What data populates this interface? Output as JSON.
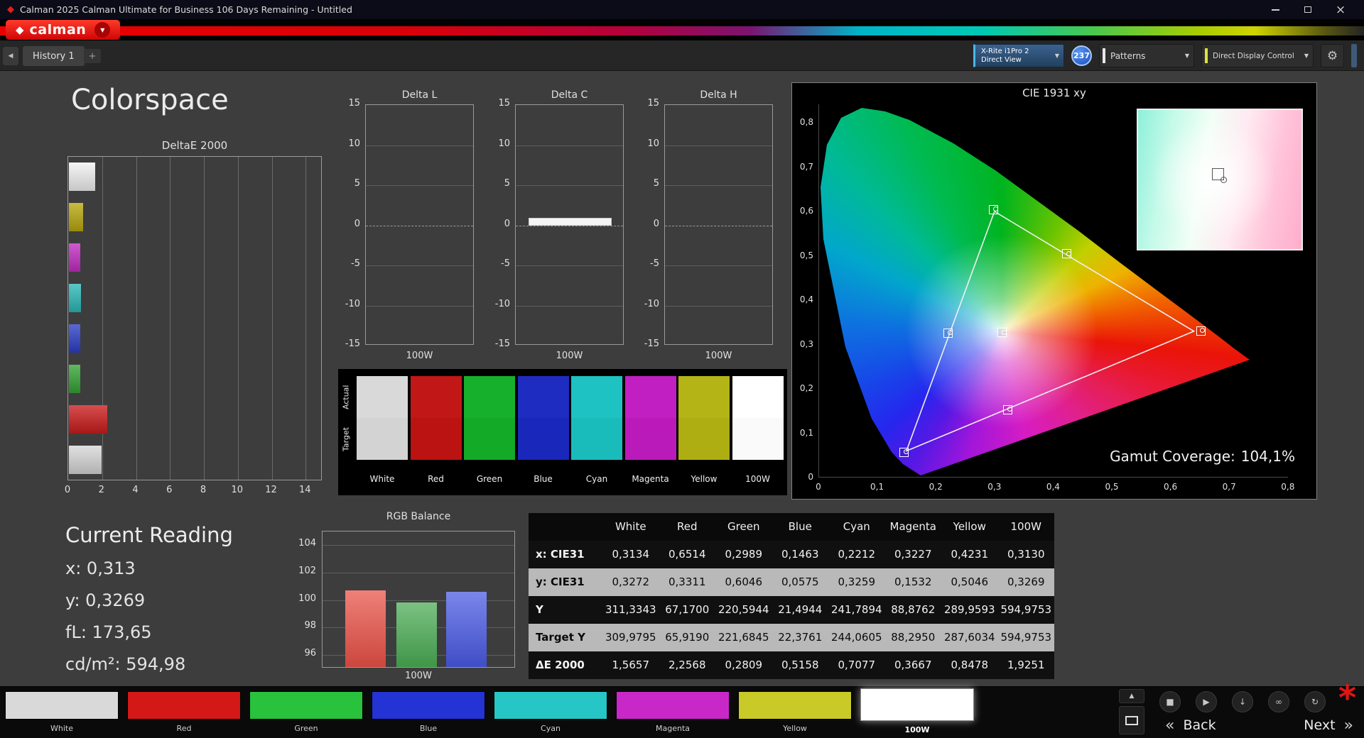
{
  "window": {
    "title": "Calman 2025 Calman Ultimate for Business 106 Days Remaining  - Untitled"
  },
  "brand": {
    "name": "calman"
  },
  "icons": {
    "app": "◆",
    "brand_mark": "◆",
    "dropdown": "▼",
    "close": "×",
    "nav_left": "◀",
    "add": "+",
    "gear": "⚙",
    "collapse_up": "▲",
    "stop": "■",
    "play": "▶",
    "save": "↓",
    "link": "∞",
    "refresh": "↻",
    "back_chevron": "«",
    "next_chevron": "»",
    "alert": "*"
  },
  "toolbar": {
    "tab": "History 1",
    "meter_line1": "X-Rite i1Pro 2",
    "meter_line2": "Direct View",
    "meter_badge": "237",
    "patterns_label": "Patterns",
    "display_control_label": "Direct Display Control"
  },
  "page_title": "Colorspace",
  "current_reading": {
    "title": "Current Reading",
    "lines": [
      "x: 0,313",
      "y: 0,3269",
      "fL: 173,65",
      "cd/m²: 594,98"
    ]
  },
  "gamut": {
    "label": "Gamut Coverage:",
    "value": "104,1%"
  },
  "swatch_strip": {
    "row_labels": [
      "Actual",
      "Target"
    ],
    "columns": [
      {
        "label": "White",
        "actual": "#d9d9d9",
        "target": "#d3d3d3"
      },
      {
        "label": "Red",
        "actual": "#c21717",
        "target": "#bb1212"
      },
      {
        "label": "Green",
        "actual": "#17b02c",
        "target": "#12aa27"
      },
      {
        "label": "Blue",
        "actual": "#1f2cc2",
        "target": "#1a27bb"
      },
      {
        "label": "Cyan",
        "actual": "#1fc2c2",
        "target": "#1abbbb"
      },
      {
        "label": "Magenta",
        "actual": "#c21fc2",
        "target": "#bb1abb"
      },
      {
        "label": "Yellow",
        "actual": "#b4b417",
        "target": "#aeae12"
      },
      {
        "label": "100W",
        "actual": "#ffffff",
        "target": "#fafafa"
      }
    ]
  },
  "bottom_bar": {
    "back": "Back",
    "next": "Next",
    "swatches": [
      {
        "label": "White",
        "color": "#d9d9d9",
        "selected": false
      },
      {
        "label": "Red",
        "color": "#d41818",
        "selected": false
      },
      {
        "label": "Green",
        "color": "#28c23c",
        "selected": false
      },
      {
        "label": "Blue",
        "color": "#2433d4",
        "selected": false
      },
      {
        "label": "Cyan",
        "color": "#26c6c6",
        "selected": false
      },
      {
        "label": "Magenta",
        "color": "#c928c9",
        "selected": false
      },
      {
        "label": "Yellow",
        "color": "#c9c928",
        "selected": false
      },
      {
        "label": "100W",
        "color": "#ffffff",
        "selected": true
      }
    ]
  },
  "chart_data": [
    {
      "id": "deltaE2000",
      "type": "bar",
      "orientation": "horizontal",
      "title": "DeltaE 2000",
      "categories": [
        "White",
        "Yellow",
        "Magenta",
        "Cyan",
        "Blue",
        "Green",
        "Red",
        "100W"
      ],
      "values": [
        1.5657,
        0.8478,
        0.3667,
        0.7077,
        0.5158,
        0.2809,
        2.2568,
        1.9251
      ],
      "bar_colors": [
        "#f2f2f2",
        "#b8a80e",
        "#c22cc2",
        "#2cb8b8",
        "#2c3ec8",
        "#34a434",
        "#cc1c1c",
        "#d8d8d8"
      ],
      "xlim": [
        0,
        15
      ],
      "xticks": [
        0,
        2,
        4,
        6,
        8,
        10,
        12,
        14
      ]
    },
    {
      "id": "deltaL",
      "type": "bar",
      "title": "Delta L",
      "categories": [
        "100W"
      ],
      "values": [
        0
      ],
      "ylim": [
        -15,
        15
      ],
      "yticks": [
        15,
        10,
        5,
        0,
        -5,
        -10,
        -15
      ],
      "xlabel": "100W"
    },
    {
      "id": "deltaC",
      "type": "bar",
      "title": "Delta C",
      "categories": [
        "100W"
      ],
      "values": [
        0.9
      ],
      "ylim": [
        -15,
        15
      ],
      "yticks": [
        15,
        10,
        5,
        0,
        -5,
        -10,
        -15
      ],
      "xlabel": "100W"
    },
    {
      "id": "deltaH",
      "type": "bar",
      "title": "Delta H",
      "categories": [
        "100W"
      ],
      "values": [
        0
      ],
      "ylim": [
        -15,
        15
      ],
      "yticks": [
        15,
        10,
        5,
        0,
        -5,
        -10,
        -15
      ],
      "xlabel": "100W"
    },
    {
      "id": "rgbBalance",
      "type": "bar",
      "title": "RGB Balance",
      "categories": [
        "Red",
        "Green",
        "Blue"
      ],
      "values": [
        100.6,
        99.7,
        100.5
      ],
      "bar_colors": [
        "#e85045",
        "#48aa52",
        "#4858e2"
      ],
      "ylim": [
        95,
        105
      ],
      "yticks": [
        96,
        98,
        100,
        102,
        104
      ],
      "xlabel": "100W"
    },
    {
      "id": "cie",
      "type": "scatter",
      "title": "CIE 1931 xy",
      "xlim": [
        0,
        0.8
      ],
      "ylim": [
        0,
        0.85
      ],
      "xticks": [
        0,
        0.1,
        0.2,
        0.3,
        0.4,
        0.5,
        0.6,
        0.7,
        0.8
      ],
      "yticks": [
        0,
        0.1,
        0.2,
        0.3,
        0.4,
        0.5,
        0.6,
        0.7,
        0.8
      ],
      "gamut_triangle": [
        [
          0.64,
          0.33
        ],
        [
          0.3,
          0.6
        ],
        [
          0.15,
          0.06
        ]
      ],
      "points": [
        {
          "name": "White",
          "x": 0.3134,
          "y": 0.3272
        },
        {
          "name": "Red",
          "x": 0.6514,
          "y": 0.3311
        },
        {
          "name": "Green",
          "x": 0.2989,
          "y": 0.6046
        },
        {
          "name": "Blue",
          "x": 0.1463,
          "y": 0.0575
        },
        {
          "name": "Cyan",
          "x": 0.2212,
          "y": 0.3259
        },
        {
          "name": "Magenta",
          "x": 0.3227,
          "y": 0.1532
        },
        {
          "name": "Yellow",
          "x": 0.4231,
          "y": 0.5046
        }
      ],
      "gamut_coverage": "104,1%"
    },
    {
      "id": "measurements",
      "type": "table",
      "columns": [
        "",
        "White",
        "Red",
        "Green",
        "Blue",
        "Cyan",
        "Magenta",
        "Yellow",
        "100W"
      ],
      "rows": [
        {
          "label": "x: CIE31",
          "shade": "dark",
          "values": [
            "0,3134",
            "0,6514",
            "0,2989",
            "0,1463",
            "0,2212",
            "0,3227",
            "0,4231",
            "0,3130"
          ]
        },
        {
          "label": "y: CIE31",
          "shade": "light",
          "values": [
            "0,3272",
            "0,3311",
            "0,6046",
            "0,0575",
            "0,3259",
            "0,1532",
            "0,5046",
            "0,3269"
          ]
        },
        {
          "label": "Y",
          "shade": "dark",
          "values": [
            "311,3343",
            "67,1700",
            "220,5944",
            "21,4944",
            "241,7894",
            "88,8762",
            "289,9593",
            "594,9753"
          ]
        },
        {
          "label": "Target Y",
          "shade": "light",
          "values": [
            "309,9795",
            "65,9190",
            "221,6845",
            "22,3761",
            "244,0605",
            "88,2950",
            "287,6034",
            "594,9753"
          ]
        },
        {
          "label": "ΔE 2000",
          "shade": "dark",
          "values": [
            "1,5657",
            "2,2568",
            "0,2809",
            "0,5158",
            "0,7077",
            "0,3667",
            "0,8478",
            "1,9251"
          ]
        }
      ]
    }
  ]
}
